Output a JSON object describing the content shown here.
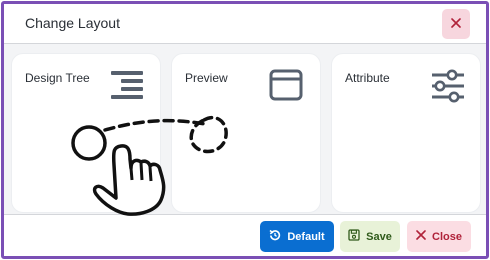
{
  "dialog": {
    "title": "Change Layout"
  },
  "header": {
    "close_icon": "x-icon"
  },
  "cards": [
    {
      "label": "Design Tree",
      "icon": "tree-list-icon"
    },
    {
      "label": "Preview",
      "icon": "window-icon"
    },
    {
      "label": "Attribute",
      "icon": "sliders-icon"
    }
  ],
  "footer": {
    "default_label": "Default",
    "default_icon": "reset-icon",
    "save_label": "Save",
    "save_icon": "floppy-disk-icon",
    "close_label": "Close",
    "close_icon": "x-icon"
  },
  "colors": {
    "border": "#7a4fb5",
    "primary": "#0a6ed1",
    "save_bg": "#e8f2d8",
    "close_bg": "#fbdde3",
    "icon": "#56606e"
  }
}
